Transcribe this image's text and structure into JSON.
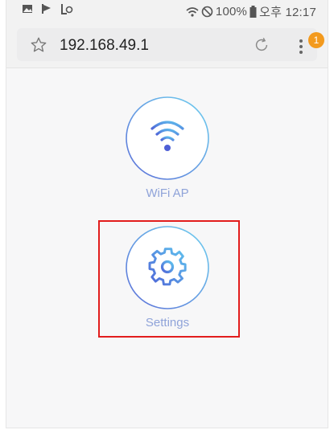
{
  "status_bar": {
    "battery_text": "100%",
    "time_text": "오후 12:17",
    "icons": [
      "image-icon",
      "flag-icon",
      "data-icon",
      "wifi-signal-icon",
      "no-disturb-icon",
      "battery-icon"
    ]
  },
  "browser": {
    "url": "192.168.49.1",
    "notification_count": "1",
    "icons": [
      "star-icon",
      "reload-icon",
      "menu-icon"
    ]
  },
  "main": {
    "tiles": [
      {
        "label": "WiFi AP",
        "icon": "wifi-icon"
      },
      {
        "label": "Settings",
        "icon": "gear-icon"
      }
    ]
  },
  "colors": {
    "accent_gradient_start": "#5b6ed8",
    "accent_gradient_end": "#6fd0ef",
    "label_color": "#8fa3d9",
    "highlight": "#e21d1d",
    "badge": "#f39a1e"
  }
}
